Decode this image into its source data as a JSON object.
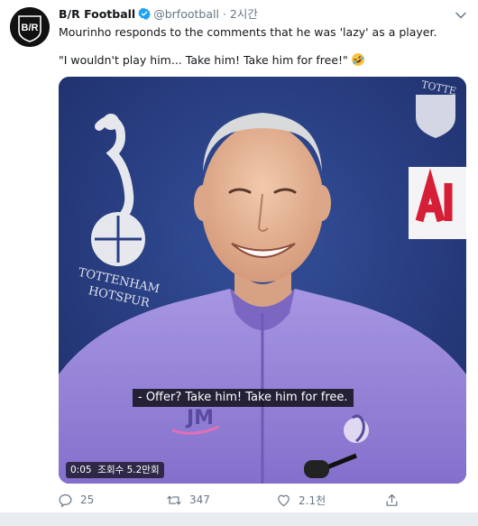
{
  "tweet": {
    "author_name": "B/R Football",
    "handle": "@brfootball",
    "separator": "·",
    "time": "2시간",
    "line1": "Mourinho responds to the comments that he was 'lazy' as a player.",
    "line2": "\"I wouldn't play him... Take him! Take him for free!\"",
    "emoji": "rolling-on-floor-laughing-emoji",
    "avatar_text": "B/R"
  },
  "media": {
    "subtitle": "- Offer? Take him! Take him for free.",
    "duration": "0:05",
    "views": "조회수 5.2만회",
    "backdrop_text": "TOTTENHAM HOTSPUR",
    "shirt_text": "JM"
  },
  "actions": {
    "reply_count": "25",
    "retweet_count": "347",
    "like_count": "2.1천"
  },
  "colors": {
    "accent": "#1da1f2",
    "secondary_text": "#657786",
    "backdrop": "#2a3e83",
    "shirt": "#9a8ad8"
  }
}
